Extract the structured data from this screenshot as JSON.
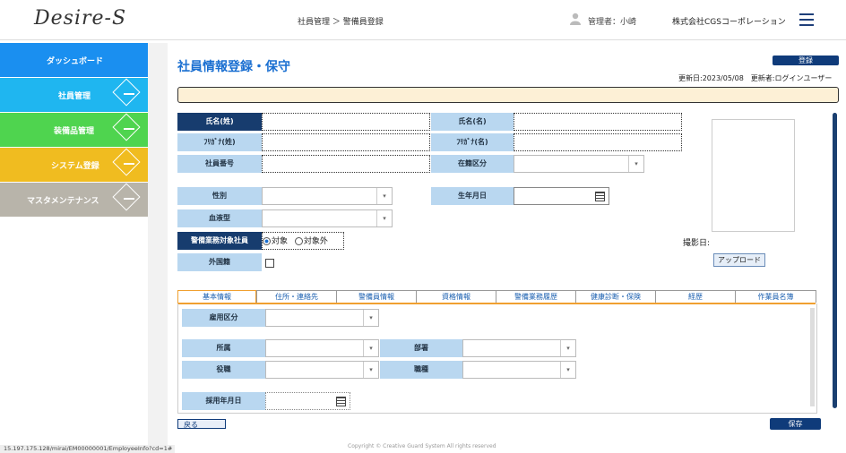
{
  "header": {
    "logo": "Desire-S",
    "breadcrumb": "社員管理 ＞ 警備員登録",
    "user": "管理者：小崎",
    "company": "株式会社CGSコーポレーション"
  },
  "sidebar": {
    "items": [
      {
        "label": "ダッシュボード",
        "color": "#1a8ff0"
      },
      {
        "label": "社員管理",
        "color": "#1fb6f0"
      },
      {
        "label": "装備品管理",
        "color": "#4fd44f"
      },
      {
        "label": "システム登録",
        "color": "#f0bc20"
      },
      {
        "label": "マスタメンテナンス",
        "color": "#b8b4aa"
      }
    ]
  },
  "page": {
    "title": "社員情報登録・保守",
    "register_button": "登録",
    "updated": "更新日:2023/05/08　更新者:ログインユーザー",
    "photo_date_label": "撮影日:",
    "upload_button": "アップロード"
  },
  "form": {
    "last_name": "氏名(姓)",
    "first_name": "氏名(名)",
    "kana_last": "ﾌﾘｶﾞﾅ(姓)",
    "kana_first": "ﾌﾘｶﾞﾅ(名)",
    "employee_no": "社員番号",
    "status": "在籍区分",
    "gender": "性別",
    "birthdate": "生年月日",
    "blood_type": "血液型",
    "guard_target": "警備業務対象社員",
    "radio_target": "対象",
    "radio_not_target": "対象外",
    "foreigner": "外国籍"
  },
  "tabs": [
    "基本情報",
    "住所・連絡先",
    "警備員情報",
    "資格情報",
    "警備業務履歴",
    "健康診断・保険",
    "経歴",
    "作業員名簿"
  ],
  "basic": {
    "employment_type": "雇用区分",
    "affiliation": "所属",
    "department": "部署",
    "position": "役職",
    "job_type": "職種",
    "hire_date": "採用年月日"
  },
  "footer": {
    "back_button": "戻る",
    "save_button": "保存",
    "copyright": "Copyright © Creative Guard System All rights reserved",
    "status_url": "15.197.175.128/mirai/EM00000001/EmployeeInfo?cd=1#"
  }
}
